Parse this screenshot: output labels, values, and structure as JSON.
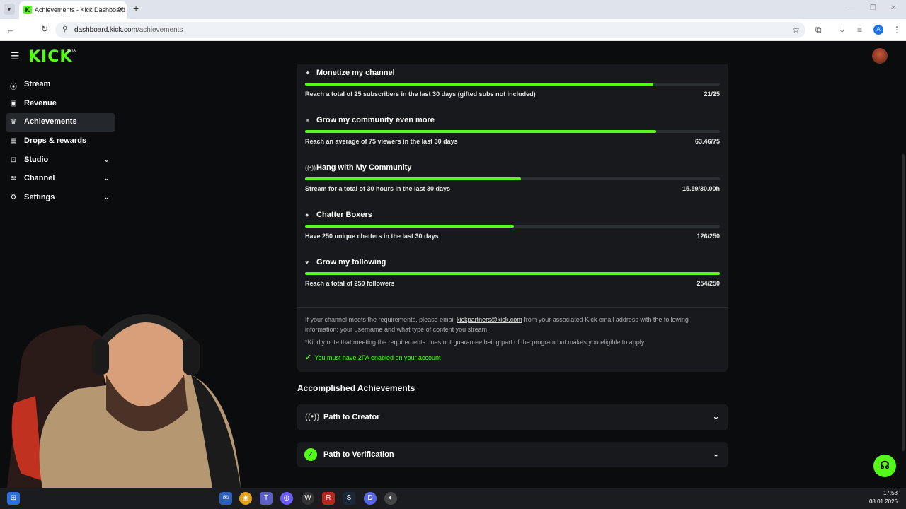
{
  "browser": {
    "tab_title": "Achievements - Kick Dashboard",
    "favicon": "K",
    "url_domain": "dashboard.kick.com",
    "url_path": "/achievements",
    "profile_initial": "A"
  },
  "header": {
    "logo": "KICK",
    "beta": "BETA"
  },
  "sidebar": {
    "items": [
      {
        "label": "Stream",
        "icon": "broadcast-icon",
        "glyph": "(•)"
      },
      {
        "label": "Revenue",
        "icon": "revenue-icon",
        "glyph": "▣"
      },
      {
        "label": "Achievements",
        "icon": "trophy-icon",
        "glyph": "🏆"
      },
      {
        "label": "Drops & rewards",
        "icon": "gift-icon",
        "glyph": "▤"
      },
      {
        "label": "Studio",
        "icon": "studio-icon",
        "glyph": "⊡"
      },
      {
        "label": "Channel",
        "icon": "channel-icon",
        "glyph": "≋"
      },
      {
        "label": "Settings",
        "icon": "gear-icon",
        "glyph": "⚙"
      }
    ],
    "active": "Achievements"
  },
  "goals": [
    {
      "title": "Monetize my channel",
      "icon": "sparkle-icon",
      "glyph": "✦",
      "description": "Reach a total of 25 subscribers in the last 30 days (gifted subs not included)",
      "value": "21/25",
      "progress": 0.84
    },
    {
      "title": "Grow my community even more",
      "icon": "community-icon",
      "glyph": "⚭",
      "description": "Reach an average of 75 viewers in the last 30 days",
      "value": "63.46/75",
      "progress": 0.8461
    },
    {
      "title": "Hang with My Community",
      "icon": "broadcast-icon",
      "glyph": "((•))",
      "description": "Stream for a total of 30 hours in the last 30 days",
      "value": "15.59/30.00h",
      "progress": 0.5197
    },
    {
      "title": "Chatter Boxers",
      "icon": "chat-icon",
      "glyph": "●",
      "description": "Have 250 unique chatters in the last 30 days",
      "value": "126/250",
      "progress": 0.504
    },
    {
      "title": "Grow my following",
      "icon": "heart-icon",
      "glyph": "♥",
      "description": "Reach a total of 250 followers",
      "value": "254/250",
      "progress": 1.0
    }
  ],
  "info": {
    "text_before": "If your channel meets the requirements, please email ",
    "email": "kickpartners@kick.com",
    "text_after": " from your associated Kick email address with the following information: your username and what type of content you stream.",
    "note": "*Kindly note that meeting the requirements does not guarantee being part of the program but makes you eligible to apply.",
    "twofa": "You must have 2FA enabled on your account"
  },
  "accomplished": {
    "heading": "Accomplished Achievements",
    "items": [
      {
        "label": "Path to Creator",
        "icon": "broadcast-icon",
        "glyph": "((•))"
      },
      {
        "label": "Path to Verification",
        "icon": "verified-badge-icon",
        "glyph": "✓"
      }
    ]
  },
  "taskbar": {
    "time": "17:58",
    "date": "08.01.2026"
  },
  "colors": {
    "accent": "#53fc18",
    "card": "#18191c",
    "background": "#0b0c0e"
  }
}
